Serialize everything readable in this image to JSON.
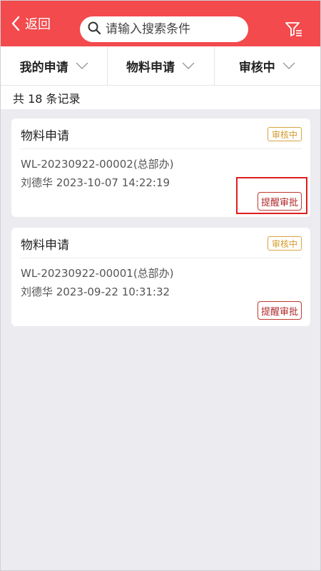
{
  "header": {
    "back_label": "返回",
    "search_placeholder": "请输入搜索条件",
    "accent_color": "#f24a4d"
  },
  "tabs": [
    {
      "label": "我的申请"
    },
    {
      "label": "物料申请"
    },
    {
      "label": "审核中"
    }
  ],
  "records": {
    "count_text": "共 18 条记录"
  },
  "cards": [
    {
      "title": "物料申请",
      "status": "审核中",
      "code": "WL-20230922-00002(总部办)",
      "meta": "刘德华 2023-10-07 14:22:19",
      "action_label": "提醒审批"
    },
    {
      "title": "物料申请",
      "status": "审核中",
      "code": "WL-20230922-00001(总部办)",
      "meta": "刘德华 2023-09-22 10:31:32",
      "action_label": "提醒审批"
    }
  ]
}
